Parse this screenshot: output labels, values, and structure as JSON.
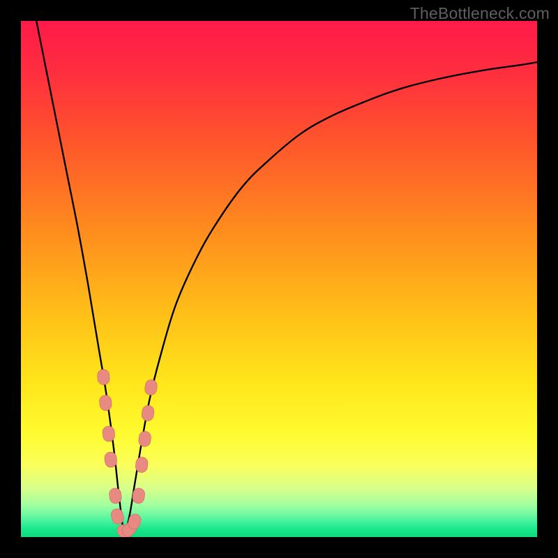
{
  "watermark": "TheBottleneck.com",
  "colors": {
    "frame": "#000000",
    "gradient_stops": [
      {
        "offset": 0.0,
        "color": "#ff1a49"
      },
      {
        "offset": 0.1,
        "color": "#ff2e3e"
      },
      {
        "offset": 0.25,
        "color": "#ff5a2a"
      },
      {
        "offset": 0.4,
        "color": "#ff8a1e"
      },
      {
        "offset": 0.55,
        "color": "#ffba18"
      },
      {
        "offset": 0.7,
        "color": "#ffe61a"
      },
      {
        "offset": 0.8,
        "color": "#fffb30"
      },
      {
        "offset": 0.86,
        "color": "#fbff5a"
      },
      {
        "offset": 0.905,
        "color": "#d8ff8a"
      },
      {
        "offset": 0.94,
        "color": "#9effa0"
      },
      {
        "offset": 0.965,
        "color": "#55f5a0"
      },
      {
        "offset": 0.985,
        "color": "#17e78a"
      },
      {
        "offset": 1.0,
        "color": "#0fdc7e"
      }
    ],
    "curve": "#000000",
    "marker_fill": "#e88a82",
    "marker_stroke": "#c96a60"
  },
  "chart_data": {
    "type": "line",
    "title": "",
    "xlabel": "",
    "ylabel": "",
    "xlim": [
      0,
      100
    ],
    "ylim": [
      0,
      100
    ],
    "grid": false,
    "legend": false,
    "note": "No axis ticks or numeric labels are visible in the image; curve values are estimated from pixel positions on a 0–100 normalized scale. y=0 is the green bottom (no bottleneck); y=100 is the red top (severe bottleneck). The curve forms a sharp V with its minimum near x≈20.",
    "optimum_x": 20,
    "series": [
      {
        "name": "bottleneck-curve",
        "x": [
          3,
          5,
          7,
          9,
          11,
          13,
          15,
          16.5,
          18,
          19,
          20,
          21,
          22,
          23.5,
          25,
          27,
          30,
          34,
          38,
          43,
          48,
          54,
          60,
          67,
          74,
          82,
          90,
          97,
          100
        ],
        "y": [
          100,
          90,
          80,
          70,
          60,
          49,
          37,
          28,
          17,
          8,
          1,
          4,
          10,
          19,
          27,
          35,
          45,
          54,
          61,
          68,
          73,
          78,
          81.5,
          84.5,
          87,
          89,
          90.5,
          91.5,
          92
        ]
      }
    ],
    "markers": {
      "name": "highlighted-points",
      "note": "Salmon pill-shaped markers clustered around the valley bottom.",
      "points": [
        {
          "x": 16.0,
          "y": 31
        },
        {
          "x": 16.4,
          "y": 26
        },
        {
          "x": 17.0,
          "y": 20
        },
        {
          "x": 17.4,
          "y": 15
        },
        {
          "x": 18.3,
          "y": 8
        },
        {
          "x": 18.7,
          "y": 4
        },
        {
          "x": 20.0,
          "y": 1
        },
        {
          "x": 21.0,
          "y": 1.5
        },
        {
          "x": 22.0,
          "y": 3
        },
        {
          "x": 22.8,
          "y": 8
        },
        {
          "x": 23.4,
          "y": 14
        },
        {
          "x": 24.0,
          "y": 19
        },
        {
          "x": 24.6,
          "y": 24
        },
        {
          "x": 25.2,
          "y": 29
        }
      ]
    }
  }
}
